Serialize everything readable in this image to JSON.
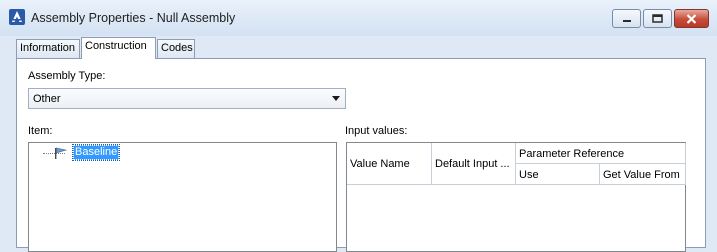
{
  "window": {
    "title": "Assembly Properties - Null Assembly",
    "icon": "autocad-civil-icon",
    "accent": "#3a6fc4",
    "close_color": "#c74c3a"
  },
  "tabs": [
    {
      "label": "Information",
      "active": false
    },
    {
      "label": "Construction",
      "active": true
    },
    {
      "label": "Codes",
      "active": false
    }
  ],
  "assembly_type": {
    "label": "Assembly Type:",
    "value": "Other"
  },
  "item": {
    "label": "Item:",
    "tree": [
      {
        "label": "Baseline",
        "icon": "baseline-flag-icon",
        "selected": true
      }
    ]
  },
  "input_values": {
    "label": "Input values:",
    "columns": {
      "value_name": "Value Name",
      "default_input": "Default Input ...",
      "parameter_reference": "Parameter Reference",
      "use": "Use",
      "get_value_from": "Get Value From"
    },
    "rows": []
  }
}
